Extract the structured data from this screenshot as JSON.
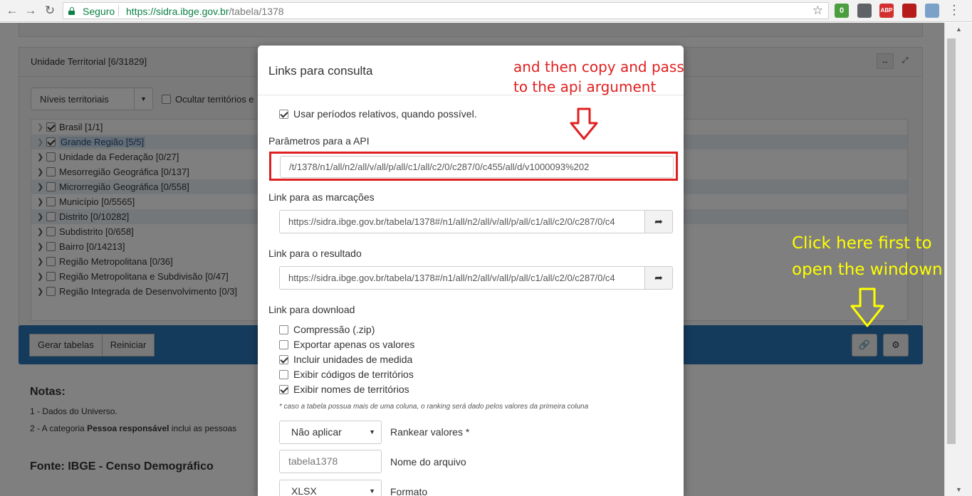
{
  "browser": {
    "secure_label": "Seguro",
    "url_host": "https://sidra.ibge.gov.br",
    "url_path": "/tabela/1378",
    "extensions": [
      {
        "name": "extension-badge",
        "text": "0",
        "color": "#4a9e3f"
      },
      {
        "name": "extension-bag",
        "text": "",
        "color": "#5f6368"
      },
      {
        "name": "adblock-plus",
        "text": "ABP",
        "color": "#d32f2f"
      },
      {
        "name": "pdf-extension",
        "text": "",
        "color": "#b71c1c"
      },
      {
        "name": "extension-tools",
        "text": "",
        "color": "#7aa2c8"
      }
    ]
  },
  "territorial_panel": {
    "title": "Unidade Territorial [6/31829]",
    "dropdown_label": "Níveis territoriais",
    "hide_label": "Ocultar territórios e",
    "tree": [
      {
        "label": "Brasil [1/1]",
        "checked": true,
        "dark": false,
        "highlight": false
      },
      {
        "label": "Grande Região [5/5]",
        "checked": true,
        "dark": false,
        "highlight": true
      },
      {
        "label": "Unidade da Federação [0/27]",
        "checked": false,
        "dark": true,
        "highlight": false
      },
      {
        "label": "Mesorregião Geográfica [0/137]",
        "checked": false,
        "dark": true,
        "highlight": false
      },
      {
        "label": "Microrregião Geográfica [0/558]",
        "checked": false,
        "dark": true,
        "highlight": false
      },
      {
        "label": "Município [0/5565]",
        "checked": false,
        "dark": true,
        "highlight": false
      },
      {
        "label": "Distrito [0/10282]",
        "checked": false,
        "dark": true,
        "highlight": false
      },
      {
        "label": "Subdistrito [0/658]",
        "checked": false,
        "dark": true,
        "highlight": false
      },
      {
        "label": "Bairro [0/14213]",
        "checked": false,
        "dark": true,
        "highlight": false
      },
      {
        "label": "Região Metropolitana [0/36]",
        "checked": false,
        "dark": true,
        "highlight": false
      },
      {
        "label": "Região Metropolitana e Subdivisão [0/47]",
        "checked": false,
        "dark": true,
        "highlight": false
      },
      {
        "label": "Região Integrada de Desenvolvimento [0/3]",
        "checked": false,
        "dark": true,
        "highlight": false
      }
    ]
  },
  "action_bar": {
    "generate_label": "Gerar tabelas",
    "reset_label": "Reiniciar"
  },
  "notes": {
    "title": "Notas:",
    "note1": "1 - Dados do Universo.",
    "note2_prefix": "2 - A categoria ",
    "note2_bold": "Pessoa responsável",
    "note2_suffix": " inclui as pessoas",
    "source": "Fonte: IBGE - Censo Demográfico"
  },
  "modal": {
    "title": "Links para consulta",
    "relative_periods": "Usar períodos relativos, quando possível.",
    "api_label": "Parâmetros para a API",
    "api_value": "/t/1378/n1/all/n2/all/v/all/p/all/c1/all/c2/0/c287/0/c455/all/d/v1000093%202",
    "markings_label": "Link para as marcações",
    "markings_value": "https://sidra.ibge.gov.br/tabela/1378#/n1/all/n2/all/v/all/p/all/c1/all/c2/0/c287/0/c4",
    "result_label": "Link para o resultado",
    "result_value": "https://sidra.ibge.gov.br/tabela/1378#/n1/all/n2/all/v/all/p/all/c1/all/c2/0/c287/0/c4",
    "download_label": "Link para download",
    "download_options": [
      {
        "label": "Compressão (.zip)",
        "checked": false
      },
      {
        "label": "Exportar apenas os valores",
        "checked": false
      },
      {
        "label": "Incluir unidades de medida",
        "checked": true
      },
      {
        "label": "Exibir códigos de territórios",
        "checked": false
      },
      {
        "label": "Exibir nomes de territórios",
        "checked": true
      }
    ],
    "ranking_hint": "* caso a tabela possua mais de uma coluna, o ranking será dado pelos valores da primeira coluna",
    "ranking_value": "Não aplicar",
    "ranking_label": "Rankear valores *",
    "filename_value": "tabela1378",
    "filename_label": "Nome do arquivo",
    "format_value": "XLSX",
    "format_label": "Formato"
  },
  "annotations": {
    "red_line1": "and then copy and pass",
    "red_line2": "to the api argument",
    "yellow_line1": "Click here first to",
    "yellow_line2": "open the windown"
  }
}
